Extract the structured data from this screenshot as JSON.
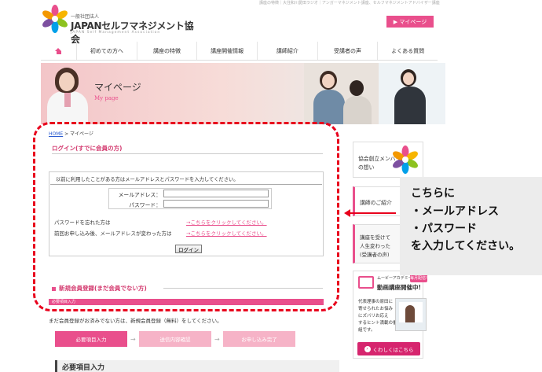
{
  "header": {
    "topline": "講座の特徴｜大住和川愛田ラジオ｜アンガーマネジメント講座、セルフマネジメントアドバイザー講座",
    "logo_sub": "一般社団法人",
    "logo_name": "JAPANセルフマネジメント協会",
    "logo_en": "JAPAN Self Management Association",
    "mypage_button": "▶ マイページ"
  },
  "nav": {
    "home_icon": "home-icon",
    "items": [
      "初めての方へ",
      "講座の特徴",
      "講座開催情報",
      "講師紹介",
      "受講者の声",
      "よくある質問"
    ]
  },
  "banner": {
    "title": "マイページ",
    "subtitle": "My page"
  },
  "breadcrumb": {
    "home": "HOME",
    "separator": " > ",
    "current": "マイページ"
  },
  "login": {
    "title": "ログイン(すでに会員の方)",
    "intro": "以前に利用したことがある方はメールアドレスとパスワードを入力してください。",
    "email_label": "メールアドレス：",
    "password_label": "パスワード：",
    "email_value": "",
    "password_value": "",
    "forgot_text": "パスワードを忘れた方は",
    "forgot_link": "→こちらをクリックしてください。",
    "changed_text": "前回お申し込み後、メールアドレスが変わった方は",
    "changed_link": "→こちらをクリックしてください。",
    "login_button": "ログイン"
  },
  "register": {
    "title": "新規会員登録(まだ会員でない方)",
    "bar_label": "必要項目入力",
    "text": "まだ会員登録がお済みでない方は、新規会員登録（無料）をしてください。",
    "steps": [
      "必要項目入力",
      "送信内容確認",
      "お申し込み完了"
    ],
    "step_arrow": "→",
    "required_heading": "必要項目入力"
  },
  "sidebar": {
    "founder_line1": "協会創立メンバー",
    "founder_line2": "の想い",
    "teacher": "講師のご紹介",
    "voice_lines": [
      "講座を受けて",
      "人生変わった",
      "(受講者の声)"
    ],
    "movie_top": "ムービーアカデミー",
    "movie_badge": "毎月配信!",
    "movie_head": "動画講座開催中!",
    "movie_text": [
      "代表理事の原田に",
      "寄せられたお悩み",
      "にズバリお応え",
      "するヒント満載の番",
      "組です。"
    ],
    "movie_button": "くわしくはこちら"
  },
  "callout": {
    "lines": [
      "こちらに",
      "・メールアドレス",
      "・パスワード",
      "を入力してください。"
    ]
  },
  "colors": {
    "accent": "#e94f8c",
    "annotation": "#e8001c"
  }
}
